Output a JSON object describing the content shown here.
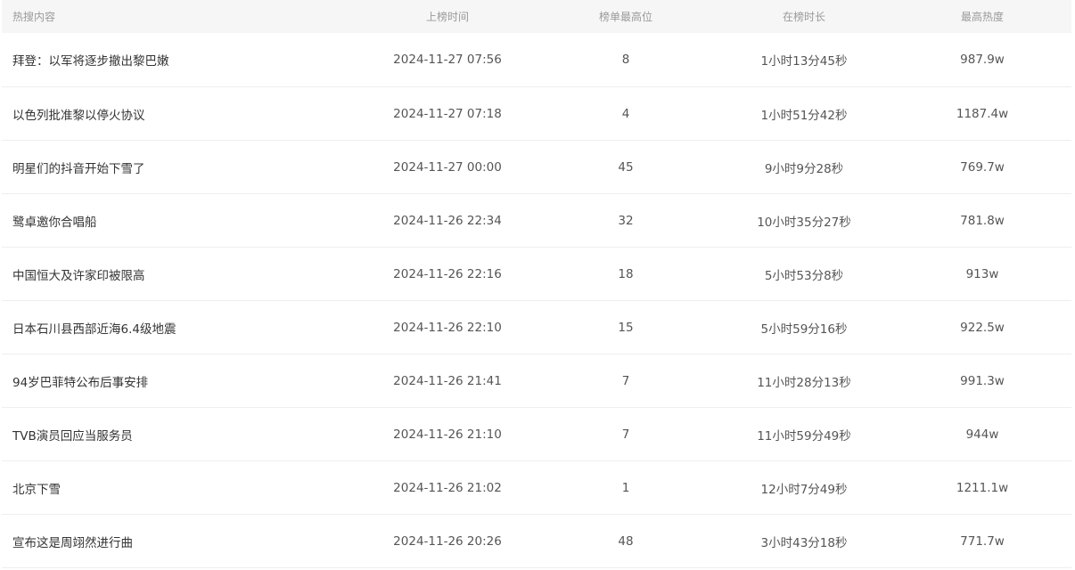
{
  "table": {
    "headers": [
      "热搜内容",
      "上榜时间",
      "榜单最高位",
      "在榜时长",
      "最高热度"
    ],
    "rows": [
      {
        "title": "拜登：以军将逐步撤出黎巴嫩",
        "time": "2024-11-27 07:56",
        "rank": "8",
        "duration": "1小时13分45秒",
        "heat": "987.9w"
      },
      {
        "title": "以色列批准黎以停火协议",
        "time": "2024-11-27 07:18",
        "rank": "4",
        "duration": "1小时51分42秒",
        "heat": "1187.4w"
      },
      {
        "title": "明星们的抖音开始下雪了",
        "time": "2024-11-27 00:00",
        "rank": "45",
        "duration": "9小时9分28秒",
        "heat": "769.7w"
      },
      {
        "title": "鹭卓邀你合唱船",
        "time": "2024-11-26 22:34",
        "rank": "32",
        "duration": "10小时35分27秒",
        "heat": "781.8w"
      },
      {
        "title": "中国恒大及许家印被限高",
        "time": "2024-11-26 22:16",
        "rank": "18",
        "duration": "5小时53分8秒",
        "heat": "913w"
      },
      {
        "title": "日本石川县西部近海6.4级地震",
        "time": "2024-11-26 22:10",
        "rank": "15",
        "duration": "5小时59分16秒",
        "heat": "922.5w"
      },
      {
        "title": "94岁巴菲特公布后事安排",
        "time": "2024-11-26 21:41",
        "rank": "7",
        "duration": "11小时28分13秒",
        "heat": "991.3w"
      },
      {
        "title": "TVB演员回应当服务员",
        "time": "2024-11-26 21:10",
        "rank": "7",
        "duration": "11小时59分49秒",
        "heat": "944w"
      },
      {
        "title": "北京下雪",
        "time": "2024-11-26 21:02",
        "rank": "1",
        "duration": "12小时7分49秒",
        "heat": "1211.1w"
      },
      {
        "title": "宣布这是周翊然进行曲",
        "time": "2024-11-26 20:26",
        "rank": "48",
        "duration": "3小时43分18秒",
        "heat": "771.7w"
      }
    ]
  }
}
